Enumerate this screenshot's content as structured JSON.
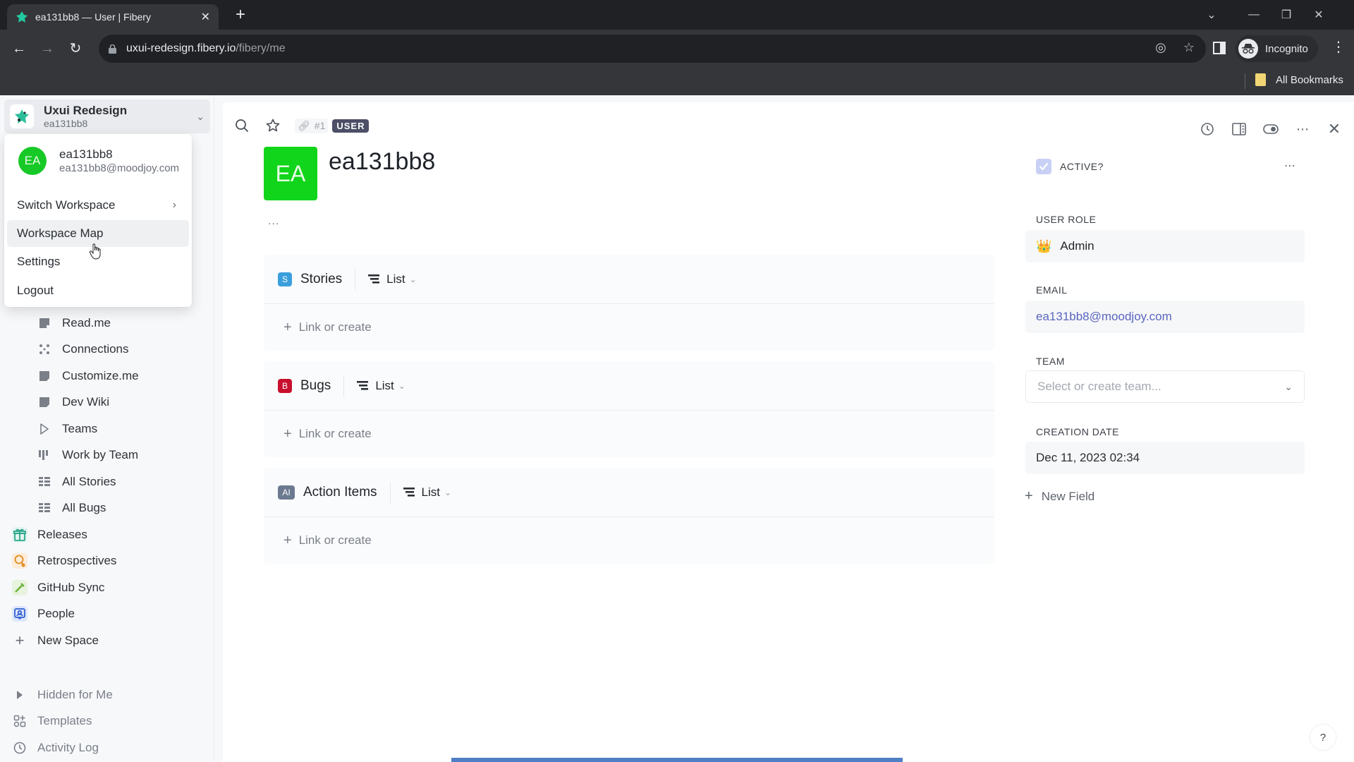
{
  "browser": {
    "tab_title": "ea131bb8 — User | Fibery",
    "url_host": "uxui-redesign.fibery.io",
    "url_path": "/fibery/me",
    "profile_label": "Incognito",
    "bookmarks_label": "All Bookmarks"
  },
  "workspace": {
    "name": "Uxui Redesign",
    "user": "ea131bb8"
  },
  "user_menu": {
    "avatar_initials": "EA",
    "name": "ea131bb8",
    "email": "ea131bb8@moodjoy.com",
    "items": [
      {
        "label": "Switch Workspace",
        "has_submenu": true
      },
      {
        "label": "Workspace Map",
        "hovered": true
      },
      {
        "label": "Settings"
      },
      {
        "label": "Logout"
      }
    ]
  },
  "sidebar": {
    "sub_items": [
      {
        "label": "Read.me",
        "icon": "document-icon"
      },
      {
        "label": "Connections",
        "icon": "connections-icon"
      },
      {
        "label": "Customize.me",
        "icon": "document-icon"
      },
      {
        "label": "Dev Wiki",
        "icon": "document-icon"
      },
      {
        "label": "Teams",
        "icon": "type-icon"
      },
      {
        "label": "Work by Team",
        "icon": "board-icon"
      },
      {
        "label": "All Stories",
        "icon": "table-icon"
      },
      {
        "label": "All Bugs",
        "icon": "table-icon"
      }
    ],
    "spaces": [
      {
        "label": "Releases",
        "icon": "gift-icon",
        "color": "#2aa58a"
      },
      {
        "label": "Retrospectives",
        "icon": "retro-icon",
        "color": "#e08a1e"
      },
      {
        "label": "GitHub Sync",
        "icon": "screw-icon",
        "color": "#6cb33f"
      },
      {
        "label": "People",
        "icon": "person-badge-icon",
        "color": "#2f5fd0"
      }
    ],
    "new_space_label": "New Space",
    "footer": [
      {
        "label": "Hidden for Me",
        "icon": "triangle-right-icon"
      },
      {
        "label": "Templates",
        "icon": "templates-icon"
      },
      {
        "label": "Activity Log",
        "icon": "clock-icon"
      }
    ]
  },
  "entity": {
    "id_label": "#1",
    "type_tag": "USER",
    "avatar_initials": "EA",
    "title": "ea131bb8",
    "more_label": "..."
  },
  "collections": [
    {
      "name": "Stories",
      "badge": "S",
      "badge_color": "#3a9fdc",
      "view": "List",
      "link_label": "Link or create"
    },
    {
      "name": "Bugs",
      "badge": "B",
      "badge_color": "#c8102e",
      "view": "List",
      "link_label": "Link or create"
    },
    {
      "name": "Action Items",
      "badge": "AI",
      "badge_color": "#6b7a90",
      "view": "List",
      "link_label": "Link or create"
    }
  ],
  "fields": {
    "active_label": "ACTIVE?",
    "active_checked": true,
    "user_role_label": "USER ROLE",
    "user_role_value": "Admin",
    "email_label": "EMAIL",
    "email_value": "ea131bb8@moodjoy.com",
    "team_label": "TEAM",
    "team_placeholder": "Select or create team...",
    "creation_date_label": "CREATION DATE",
    "creation_date_value": "Dec 11, 2023 02:34",
    "new_field_label": "New Field"
  },
  "help_label": "?"
}
